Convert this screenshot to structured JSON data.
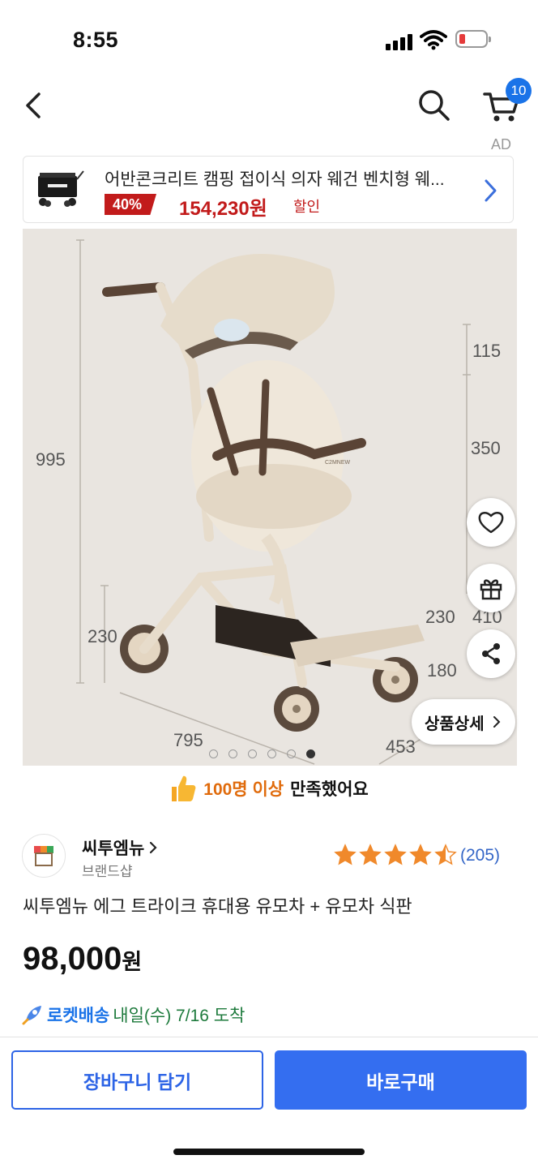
{
  "status_bar": {
    "time": "8:55"
  },
  "header": {
    "cart_count": "10"
  },
  "ad": {
    "label": "AD",
    "title": "어반콘크리트 캠핑 접이식 의자 웨건 벤치형 웨...",
    "discount": "40%",
    "price": "154,230원",
    "sale_text": "할인"
  },
  "gallery": {
    "dimensions": {
      "height_total": "995",
      "wheel_height": "230",
      "length": "795",
      "width": "453",
      "canopy": "115",
      "seat": "350",
      "side_a": "230",
      "side_b": "410",
      "footrest": "180"
    },
    "brand_mark": "C2MNEW",
    "detail_button": "상품상세",
    "dots_total": 6,
    "active_dot": 5
  },
  "satisfaction": {
    "highlight": "100명 이상",
    "text": "만족했어요"
  },
  "seller": {
    "name": "씨투엠뉴",
    "subtitle": "브랜드샵"
  },
  "rating": {
    "stars": 4.5,
    "count": "(205)"
  },
  "product": {
    "name": "씨투엠뉴 에그 트라이크 휴대용 유모차 + 유모차 식판",
    "price_number": "98,000",
    "price_unit": "원"
  },
  "delivery": {
    "badge": "로켓배송",
    "text": "내일(수) 7/16 도착"
  },
  "actions": {
    "cart_button": "장바구니 담기",
    "buy_button": "바로구매"
  },
  "colors": {
    "accent": "#346ef0",
    "discount_red": "#c21b1b",
    "rocket_blue": "#1a73e8"
  }
}
